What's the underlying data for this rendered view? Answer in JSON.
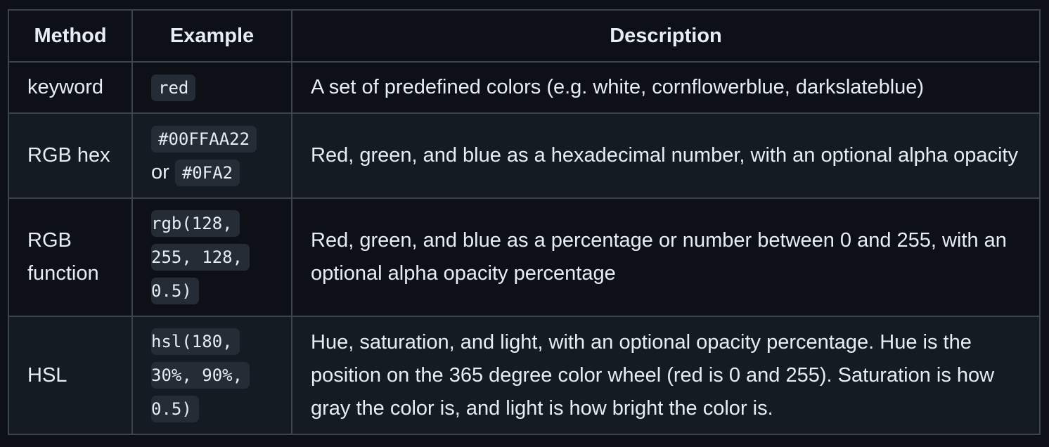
{
  "table": {
    "headers": [
      "Method",
      "Example",
      "Description"
    ],
    "rows": [
      {
        "method": "keyword",
        "example_code_1": "red",
        "description": "A set of predefined colors (e.g. white, cornflowerblue, darkslateblue)"
      },
      {
        "method": "RGB hex",
        "example_code_1": "#00FFAA22",
        "example_connector": "or",
        "example_code_2": "#0FA2",
        "description": "Red, green, and blue as a hexadecimal number, with an optional alpha opacity"
      },
      {
        "method": "RGB function",
        "example_code_1": "rgb(128, 255, 128, 0.5)",
        "description": "Red, green, and blue as a percentage or number between 0 and 255, with an optional alpha opacity percentage"
      },
      {
        "method": "HSL",
        "example_code_1": "hsl(180, 30%, 90%, 0.5)",
        "description": "Hue, saturation, and light, with an optional opacity percentage. Hue is the position on the 365 degree color wheel (red is 0 and 255). Saturation is how gray the color is, and light is how bright the color is."
      }
    ]
  }
}
